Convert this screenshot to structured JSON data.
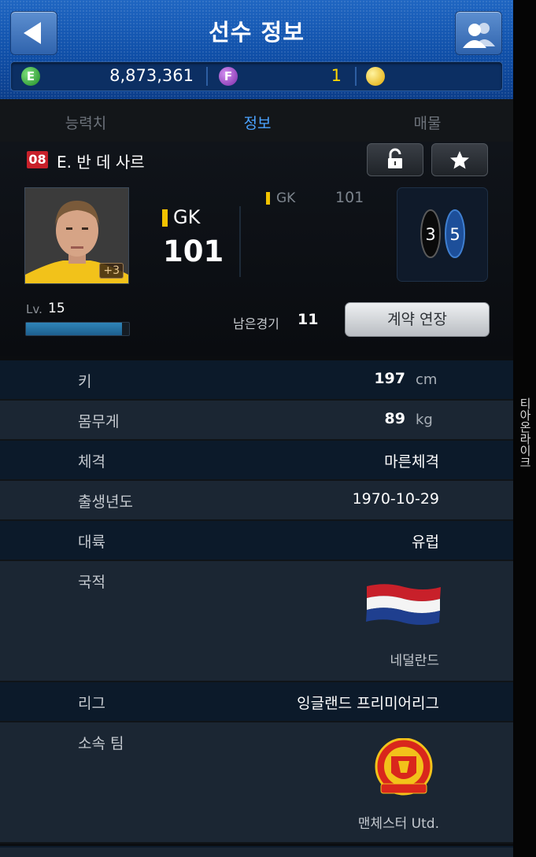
{
  "header": {
    "title": "선수 정보",
    "e_points": "8,873,361",
    "f_points": "1"
  },
  "tabs": [
    {
      "label": "능력치",
      "active": false
    },
    {
      "label": "정보",
      "active": true
    },
    {
      "label": "매물",
      "active": false
    }
  ],
  "player": {
    "number": "08",
    "name": "E. 반 데 사르",
    "plus_badge": "+3",
    "position": "GK",
    "overall": "101",
    "secondary_position": "GK",
    "secondary_overall": "101",
    "foot_left": "3",
    "foot_right": "5",
    "level_label": "Lv.",
    "level": "15",
    "level_progress": 0.93,
    "remaining_games_label": "남은경기",
    "remaining_games": "11",
    "extend_button": "계약 연장"
  },
  "info": {
    "height": {
      "label": "키",
      "value": "197",
      "unit": "cm"
    },
    "weight": {
      "label": "몸무게",
      "value": "89",
      "unit": "kg"
    },
    "body_type": {
      "label": "체격",
      "value": "마른체격"
    },
    "birth": {
      "label": "출생년도",
      "value": "1970-10-29"
    },
    "continent": {
      "label": "대륙",
      "value": "유럽"
    },
    "nationality": {
      "label": "국적",
      "value": "네덜란드"
    },
    "league": {
      "label": "리그",
      "value": "잉글랜드 프리미어리그"
    },
    "club": {
      "label": "소속 팀",
      "value": "맨체스터 Utd."
    }
  },
  "watermark": "티아온라이크",
  "colors": {
    "header_blue": "#0f4fa8",
    "active_tab": "#4ba3ff",
    "position_gold": "#f2c200",
    "badge_red": "#c8202a"
  }
}
